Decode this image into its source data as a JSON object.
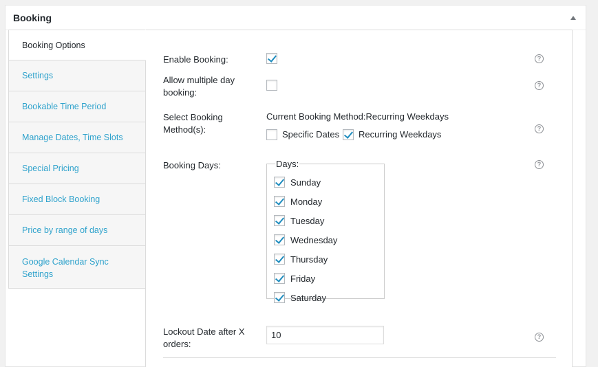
{
  "box": {
    "title": "Booking"
  },
  "tabs": [
    {
      "label": "Booking Options",
      "active": true
    },
    {
      "label": "Settings"
    },
    {
      "label": "Bookable Time Period"
    },
    {
      "label": "Manage Dates, Time Slots"
    },
    {
      "label": "Special Pricing"
    },
    {
      "label": "Fixed Block Booking"
    },
    {
      "label": "Price by range of days"
    },
    {
      "label": "Google Calendar Sync Settings"
    }
  ],
  "fields": {
    "enable_booking": {
      "label": "Enable Booking:",
      "checked": true
    },
    "multiple_day": {
      "label": "Allow multiple day booking:",
      "checked": false
    },
    "booking_method": {
      "label": "Select Booking Method(s):",
      "current_text": "Current Booking Method:Recurring Weekdays",
      "options": [
        {
          "label": "Specific Dates",
          "checked": false
        },
        {
          "label": "Recurring Weekdays",
          "checked": true
        }
      ]
    },
    "booking_days": {
      "label": "Booking Days:",
      "legend": "Days:",
      "days": [
        {
          "label": "Sunday",
          "checked": true
        },
        {
          "label": "Monday",
          "checked": true
        },
        {
          "label": "Tuesday",
          "checked": true
        },
        {
          "label": "Wednesday",
          "checked": true
        },
        {
          "label": "Thursday",
          "checked": true
        },
        {
          "label": "Friday",
          "checked": true
        },
        {
          "label": "Saturday",
          "checked": true
        }
      ]
    },
    "lockout": {
      "label": "Lockout Date after X orders:",
      "value": "10"
    }
  },
  "help_icon": "question-circle-icon",
  "colors": {
    "link": "#2ea2cc",
    "check": "#1e8cbe"
  }
}
